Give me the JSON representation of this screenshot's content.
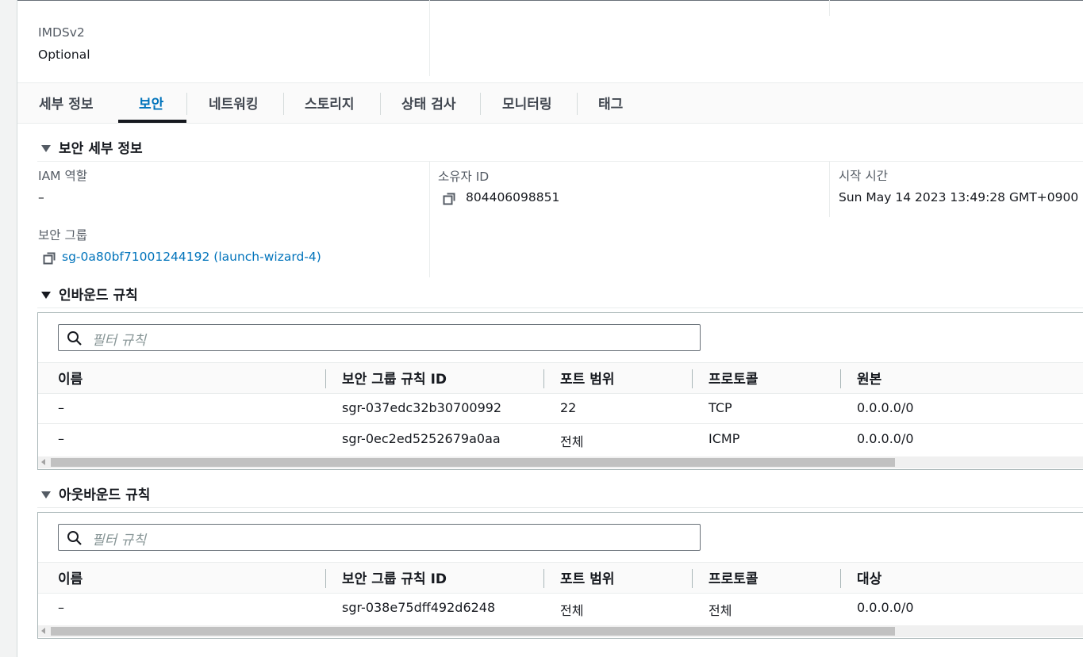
{
  "top_section": {
    "imds_label": "IMDSv2",
    "imds_value": "Optional"
  },
  "tabs": [
    {
      "label": "세부 정보"
    },
    {
      "label": "보안"
    },
    {
      "label": "네트워킹"
    },
    {
      "label": "스토리지"
    },
    {
      "label": "상태 검사"
    },
    {
      "label": "모니터링"
    },
    {
      "label": "태그"
    }
  ],
  "active_tab": "보안",
  "security_details": {
    "title": "보안 세부 정보",
    "iam_role_label": "IAM 역할",
    "iam_role_value": "–",
    "owner_id_label": "소유자 ID",
    "owner_id_value": "804406098851",
    "start_time_label": "시작 시간",
    "start_time_value": "Sun May 14 2023 13:49:28 GMT+0900",
    "security_groups_label": "보안 그룹",
    "security_group_link": "sg-0a80bf71001244192 (launch-wizard-4)"
  },
  "inbound": {
    "title": "인바운드 규칙",
    "filter_placeholder": "필터 규칙",
    "columns": [
      "이름",
      "보안 그룹 규칙 ID",
      "포트 범위",
      "프로토콜",
      "원본"
    ],
    "rows": [
      [
        "–",
        "sgr-037edc32b30700992",
        "22",
        "TCP",
        "0.0.0.0/0"
      ],
      [
        "–",
        "sgr-0ec2ed5252679a0aa",
        "전체",
        "ICMP",
        "0.0.0.0/0"
      ]
    ]
  },
  "outbound": {
    "title": "아웃바운드 규칙",
    "filter_placeholder": "필터 규칙",
    "columns": [
      "이름",
      "보안 그룹 규칙 ID",
      "포트 범위",
      "프로토콜",
      "대상"
    ],
    "rows": [
      [
        "–",
        "sgr-038e75dff492d6248",
        "전체",
        "전체",
        "0.0.0.0/0"
      ]
    ]
  },
  "colors": {
    "link": "#0073bb",
    "tab_active": "#0073bb",
    "text": "#16191f"
  }
}
